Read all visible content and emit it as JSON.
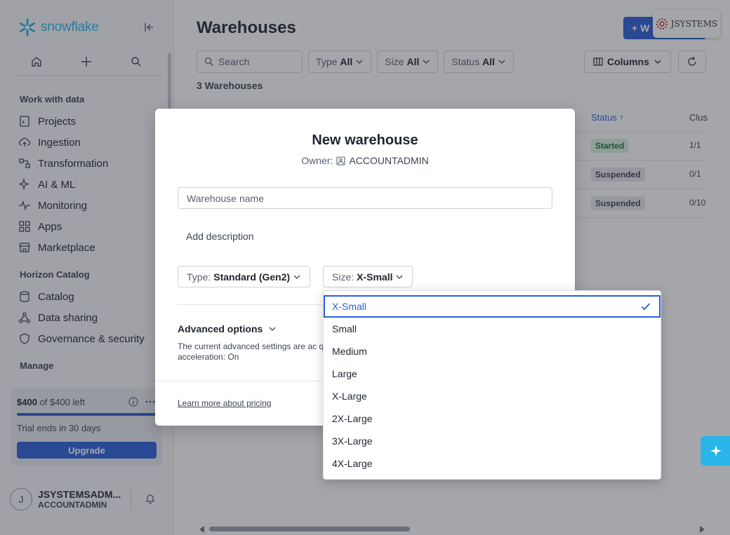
{
  "app": {
    "logo_text": "snowflake"
  },
  "sidebar": {
    "sections": {
      "work": "Work with data",
      "horizon": "Horizon Catalog",
      "manage": "Manage"
    },
    "items": [
      {
        "label": "Projects",
        "icon": "document-icon"
      },
      {
        "label": "Ingestion",
        "icon": "cloud-upload-icon"
      },
      {
        "label": "Transformation",
        "icon": "transform-icon"
      },
      {
        "label": "AI & ML",
        "icon": "sparkle-icon"
      },
      {
        "label": "Monitoring",
        "icon": "pulse-icon"
      },
      {
        "label": "Apps",
        "icon": "grid-icon"
      },
      {
        "label": "Marketplace",
        "icon": "store-icon"
      },
      {
        "label": "Catalog",
        "icon": "database-icon"
      },
      {
        "label": "Data sharing",
        "icon": "share-icon"
      },
      {
        "label": "Governance & security",
        "icon": "shield-icon"
      }
    ],
    "credits": {
      "amount": "$400",
      "amount_suffix": " of $400 left",
      "trial": "Trial ends in 30 days",
      "upgrade_label": "Upgrade",
      "remaining_fraction": 1.0
    },
    "user": {
      "initial": "J",
      "name": "JSYSTEMSADM...",
      "role": "ACCOUNTADMIN"
    }
  },
  "main": {
    "title": "Warehouses",
    "new_button_label": "+ W",
    "search_placeholder": "Search",
    "filters": [
      {
        "label": "Type",
        "value": "All"
      },
      {
        "label": "Size",
        "value": "All"
      },
      {
        "label": "Status",
        "value": "All"
      }
    ],
    "columns_label": "Columns",
    "count_label": "3 Warehouses",
    "table": {
      "headers": {
        "status": "Status",
        "clusters": "Clus"
      },
      "rows": [
        {
          "status": "Started",
          "clusters": "1/1"
        },
        {
          "status": "Suspended",
          "clusters": "0/1"
        },
        {
          "status": "Suspended",
          "clusters": "0/10"
        }
      ]
    },
    "watermark": "JSYSTEMS"
  },
  "modal": {
    "title": "New warehouse",
    "owner_label": "Owner:",
    "owner_value": "ACCOUNTADMIN",
    "name_placeholder": "Warehouse name",
    "add_description": "Add description",
    "type_label": "Type:",
    "type_value": "Standard (Gen2)",
    "size_label": "Size:",
    "size_value": "X-Small",
    "advanced_label": "Advanced options",
    "advanced_desc": "The current advanced settings are ac query acceleration: On",
    "pricing_link": "Learn more about pricing"
  },
  "dropdown": {
    "options": [
      "X-Small",
      "Small",
      "Medium",
      "Large",
      "X-Large",
      "2X-Large",
      "3X-Large",
      "4X-Large"
    ],
    "selected": "X-Small"
  },
  "colors": {
    "accent": "#2a5fd9",
    "brand": "#29b5e8",
    "started": "#d6f2e0",
    "suspended": "#e5e7ea"
  }
}
